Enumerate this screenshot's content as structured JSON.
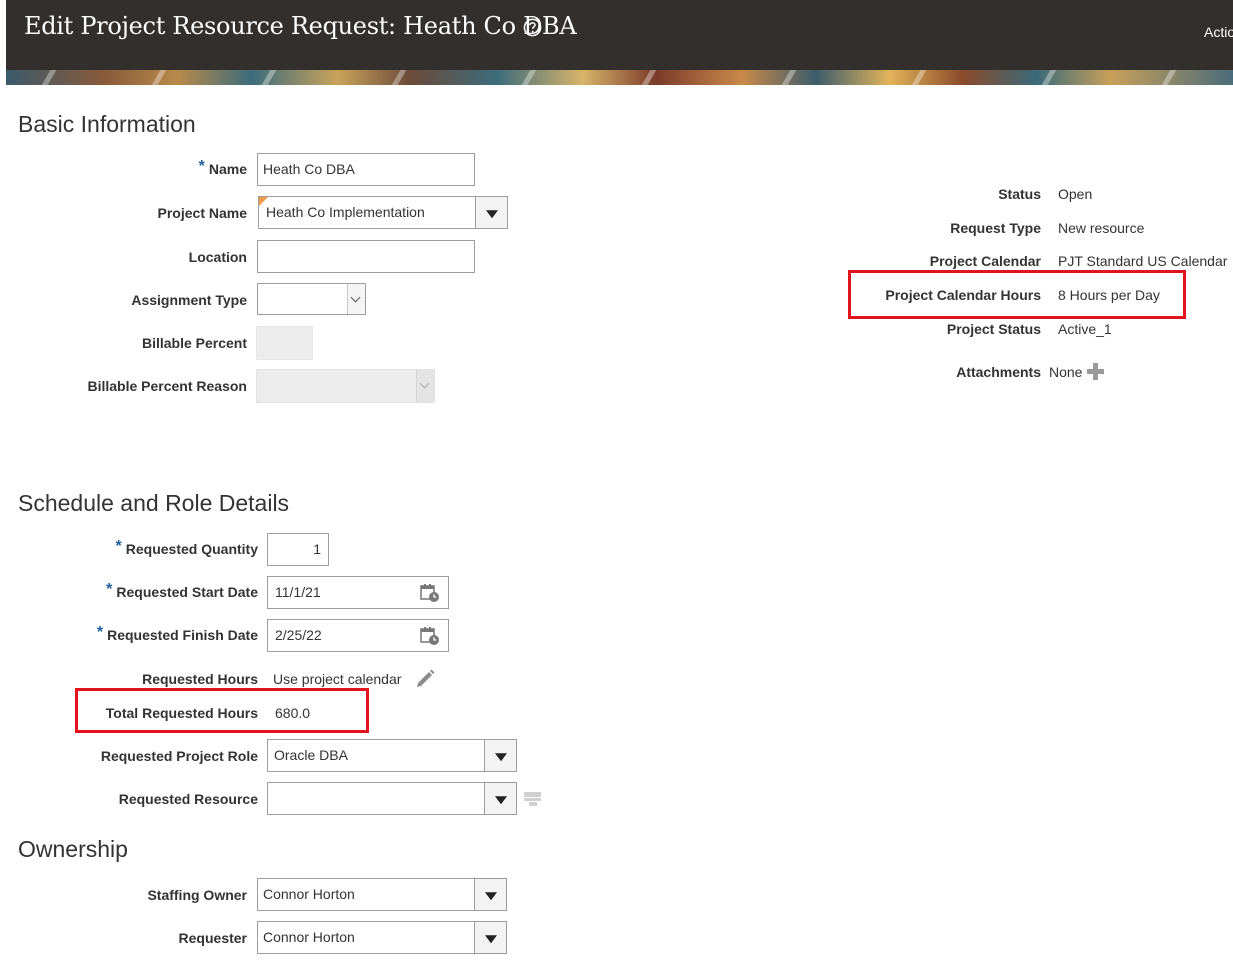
{
  "header": {
    "title": "Edit Project Resource Request: Heath Co DBA",
    "actions_label": "Actio"
  },
  "basic_info": {
    "section_title": "Basic Information",
    "name": {
      "label": "Name",
      "value": "Heath Co DBA",
      "required": true
    },
    "project_name": {
      "label": "Project Name",
      "value": "Heath Co Implementation"
    },
    "location": {
      "label": "Location",
      "value": ""
    },
    "assignment_type": {
      "label": "Assignment Type",
      "value": ""
    },
    "billable_percent": {
      "label": "Billable Percent",
      "value": ""
    },
    "billable_percent_reason": {
      "label": "Billable Percent Reason",
      "value": ""
    }
  },
  "summary": {
    "status": {
      "label": "Status",
      "value": "Open"
    },
    "request_type": {
      "label": "Request Type",
      "value": "New resource"
    },
    "project_calendar": {
      "label": "Project Calendar",
      "value": "PJT Standard US Calendar"
    },
    "project_calendar_hours": {
      "label": "Project Calendar Hours",
      "value": "8 Hours per Day"
    },
    "project_status": {
      "label": "Project Status",
      "value": "Active_1"
    },
    "attachments": {
      "label": "Attachments",
      "value": "None"
    }
  },
  "schedule": {
    "section_title": "Schedule and Role Details",
    "requested_quantity": {
      "label": "Requested Quantity",
      "value": "1"
    },
    "requested_start_date": {
      "label": "Requested Start Date",
      "value": "11/1/21"
    },
    "requested_finish_date": {
      "label": "Requested Finish Date",
      "value": "2/25/22"
    },
    "requested_hours": {
      "label": "Requested Hours",
      "value": "Use project calendar"
    },
    "total_requested_hours": {
      "label": "Total Requested Hours",
      "value": "680.0"
    },
    "requested_project_role": {
      "label": "Requested Project Role",
      "value": "Oracle DBA"
    },
    "requested_resource": {
      "label": "Requested Resource",
      "value": ""
    }
  },
  "ownership": {
    "section_title": "Ownership",
    "staffing_owner": {
      "label": "Staffing Owner",
      "value": "Connor Horton"
    },
    "requester": {
      "label": "Requester",
      "value": "Connor Horton"
    }
  },
  "colors": {
    "header_bg": "#332f2c",
    "required_marker": "#1e5fa0",
    "highlight": "#e2131f"
  },
  "icons": [
    "help-icon",
    "chevron-down-icon",
    "calendar-icon",
    "edit-pencil-icon",
    "add-icon",
    "search-resource-icon"
  ]
}
